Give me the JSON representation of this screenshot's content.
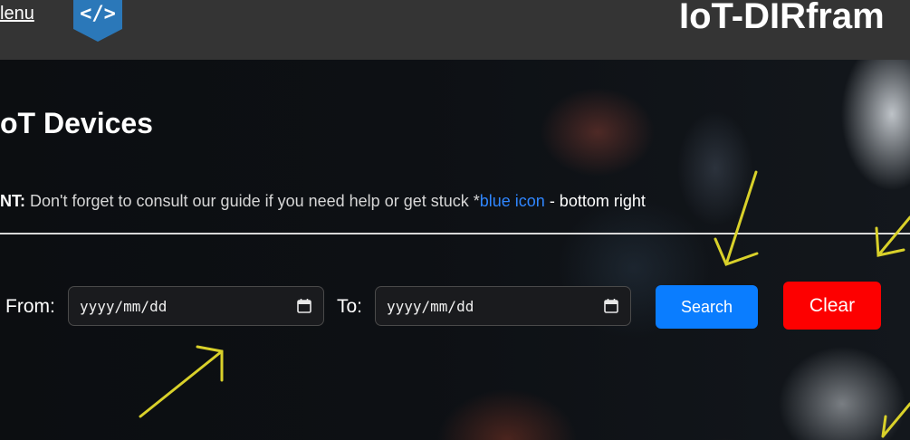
{
  "header": {
    "menu_label": "lenu",
    "app_title": "IoT-DIRfram"
  },
  "main": {
    "page_title": "oT Devices",
    "hint": {
      "prefix": "NT:",
      "text": " Don't forget to consult our guide if you need help or get stuck *",
      "blue_text": "blue icon",
      "suffix": " - bottom right"
    }
  },
  "filter": {
    "from_label": "From:",
    "from_placeholder": "yyyy/mm/dd",
    "to_label": "To:",
    "to_placeholder": "yyyy/mm/dd",
    "search_label": "Search",
    "clear_label": "Clear"
  },
  "colors": {
    "header_bg": "#343434",
    "search_button": "#0a7dff",
    "clear_button": "#fd0000",
    "hint_link": "#2f86ff",
    "annotation_arrows": "#d9d12a"
  }
}
